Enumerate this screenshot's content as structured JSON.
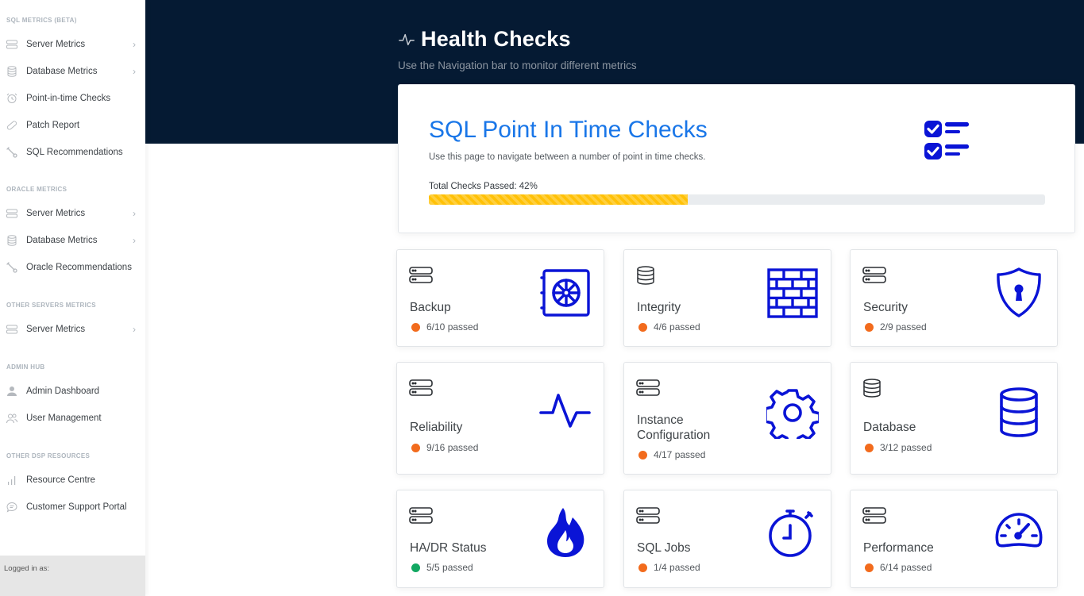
{
  "sidebar": {
    "sections": [
      {
        "heading": "SQL METRICS (BETA)",
        "items": [
          {
            "label": "Server Metrics",
            "icon": "server-icon",
            "has_submenu": true
          },
          {
            "label": "Database Metrics",
            "icon": "database-icon",
            "has_submenu": true
          },
          {
            "label": "Point-in-time Checks",
            "icon": "alarm-clock-icon",
            "has_submenu": false
          },
          {
            "label": "Patch Report",
            "icon": "bandage-icon",
            "has_submenu": false
          },
          {
            "label": "SQL Recommendations",
            "icon": "wrench-icon",
            "has_submenu": false
          }
        ]
      },
      {
        "heading": "ORACLE METRICS",
        "items": [
          {
            "label": "Server Metrics",
            "icon": "server-icon",
            "has_submenu": true
          },
          {
            "label": "Database Metrics",
            "icon": "database-icon",
            "has_submenu": true
          },
          {
            "label": "Oracle Recommendations",
            "icon": "wrench-icon",
            "has_submenu": false
          }
        ]
      },
      {
        "heading": "OTHER SERVERS METRICS",
        "items": [
          {
            "label": "Server Metrics",
            "icon": "server-icon",
            "has_submenu": true
          }
        ]
      },
      {
        "heading": "ADMIN HUB",
        "items": [
          {
            "label": "Admin Dashboard",
            "icon": "user-icon",
            "has_submenu": false
          },
          {
            "label": "User Management",
            "icon": "users-icon",
            "has_submenu": false
          }
        ]
      },
      {
        "heading": "OTHER DSP RESOURCES",
        "items": [
          {
            "label": "Resource Centre",
            "icon": "bar-chart-icon",
            "has_submenu": false
          },
          {
            "label": "Customer Support Portal",
            "icon": "chat-icon",
            "has_submenu": false
          }
        ]
      }
    ],
    "chevron": "›",
    "logged_in_label": "Logged in as:"
  },
  "header": {
    "title": "Health Checks",
    "title_icon": "activity-icon",
    "subtitle": "Use the Navigation bar to monitor different metrics"
  },
  "summary": {
    "title": "SQL Point In Time Checks",
    "description": "Use this page to navigate between a number of point in time checks.",
    "progress_label": "Total Checks Passed: 42%",
    "progress_percent": 42,
    "icon": "checklist-icon"
  },
  "colors": {
    "header_bg": "#051a33",
    "accent_blue": "#1976e8",
    "icon_blue": "#0a14d6",
    "progress": "#ffc107",
    "status_warning": "#f26b1d",
    "status_ok": "#12a862"
  },
  "checks": [
    {
      "name": "Backup",
      "status": "6/10 passed",
      "level": "warning",
      "small_icon": "server-icon",
      "big_icon": "safe-icon"
    },
    {
      "name": "Integrity",
      "status": "4/6 passed",
      "level": "warning",
      "small_icon": "database-icon",
      "big_icon": "brick-wall-icon"
    },
    {
      "name": "Security",
      "status": "2/9 passed",
      "level": "warning",
      "small_icon": "server-icon",
      "big_icon": "shield-keyhole-icon"
    },
    {
      "name": "Reliability",
      "status": "9/16 passed",
      "level": "warning",
      "small_icon": "server-icon",
      "big_icon": "pulse-icon"
    },
    {
      "name": "Instance Configuration",
      "status": "4/17 passed",
      "level": "warning",
      "small_icon": "server-icon",
      "big_icon": "gear-icon"
    },
    {
      "name": "Database",
      "status": "3/12 passed",
      "level": "warning",
      "small_icon": "database-icon",
      "big_icon": "database-icon"
    },
    {
      "name": "HA/DR Status",
      "status": "5/5 passed",
      "level": "ok",
      "small_icon": "server-icon",
      "big_icon": "flame-icon"
    },
    {
      "name": "SQL Jobs",
      "status": "1/4 passed",
      "level": "warning",
      "small_icon": "server-icon",
      "big_icon": "stopwatch-icon"
    },
    {
      "name": "Performance",
      "status": "6/14 passed",
      "level": "warning",
      "small_icon": "server-icon",
      "big_icon": "speedometer-icon"
    }
  ]
}
